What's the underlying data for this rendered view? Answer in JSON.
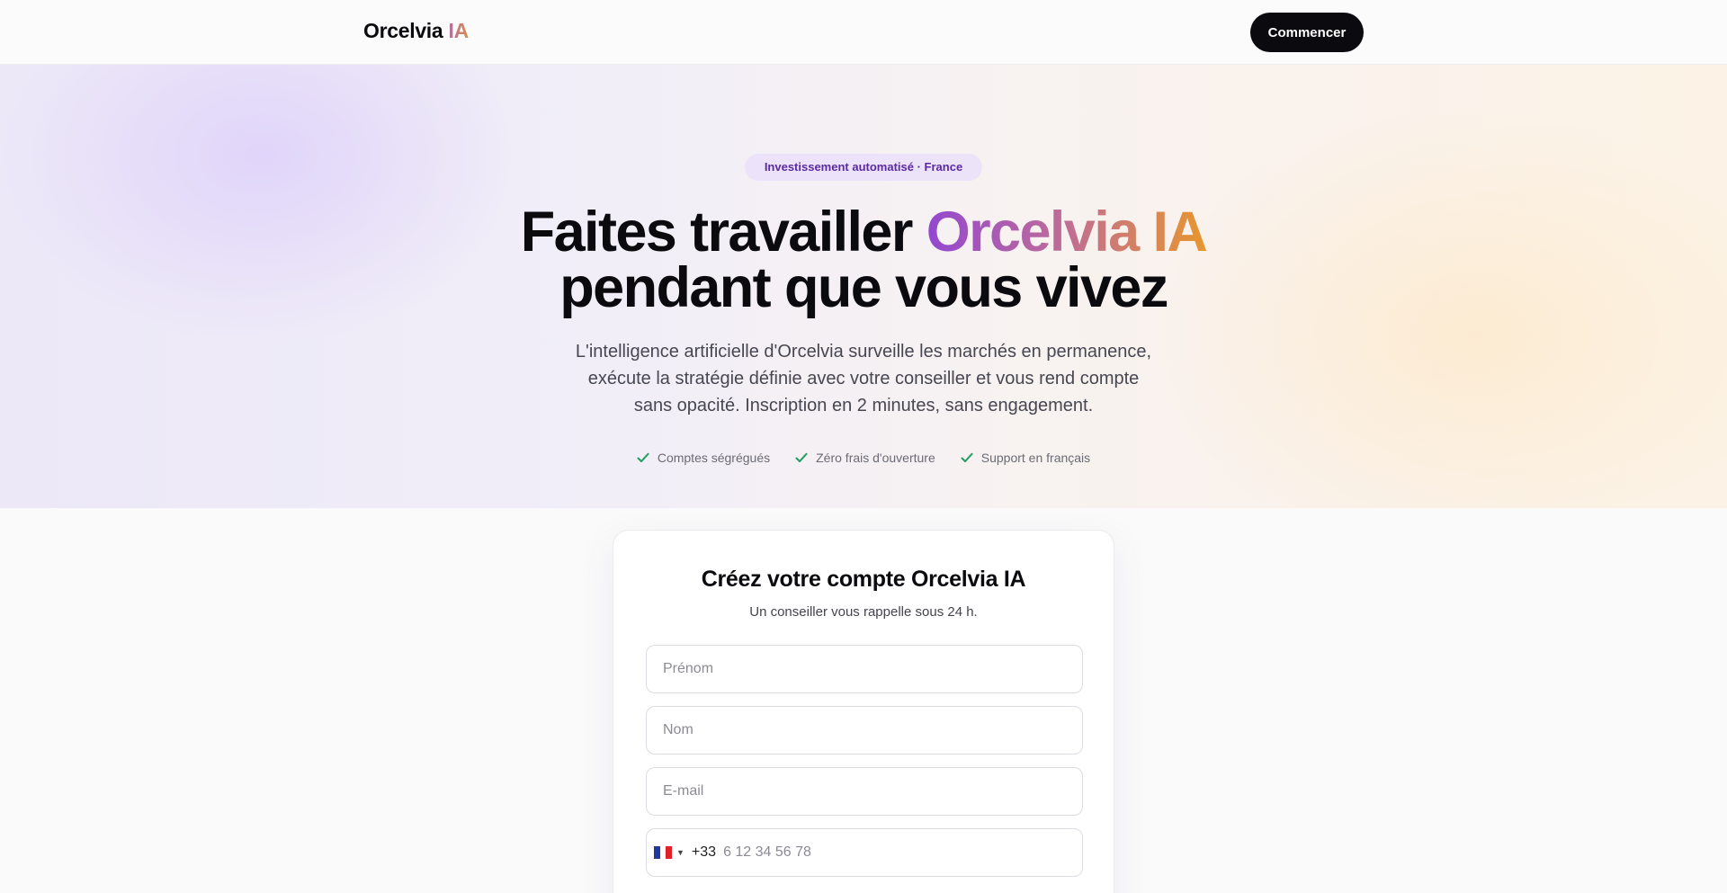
{
  "nav": {
    "brand_name": "Orcelvia",
    "brand_suffix": "IA",
    "cta_label": "Commencer"
  },
  "hero": {
    "badge": "Investissement automatisé · France",
    "headline_part1": "Faites travailler ",
    "headline_highlight": "Orcelvia IA",
    "headline_part2": "pendant que vous vivez",
    "subtitle_line1": "L'intelligence artificielle d'Orcelvia surveille les marchés en permanence,",
    "subtitle_line2": "exécute la stratégie définie avec votre conseiller et vous rend compte",
    "subtitle_line3": "sans opacité. Inscription en 2 minutes, sans engagement.",
    "checks": [
      {
        "label": "Comptes ségrégués",
        "icon": "check-icon"
      },
      {
        "label": "Zéro frais d'ouverture",
        "icon": "check-icon"
      },
      {
        "label": "Support en français",
        "icon": "check-icon"
      }
    ]
  },
  "form": {
    "title": "Créez votre compte Orcelvia IA",
    "subtitle": "Un conseiller vous rappelle sous 24 h.",
    "first_name_placeholder": "Prénom",
    "last_name_placeholder": "Nom",
    "email_placeholder": "E-mail",
    "phone": {
      "country_flag": "france-flag-icon",
      "dial_code": "+33",
      "placeholder": "6 12 34 56 78"
    }
  },
  "colors": {
    "accent_purple": "#9348d0",
    "accent_orange": "#e7962f",
    "check_green": "#1f9d63",
    "badge_text": "#5b2aa3",
    "dark": "#0b0b0f"
  }
}
